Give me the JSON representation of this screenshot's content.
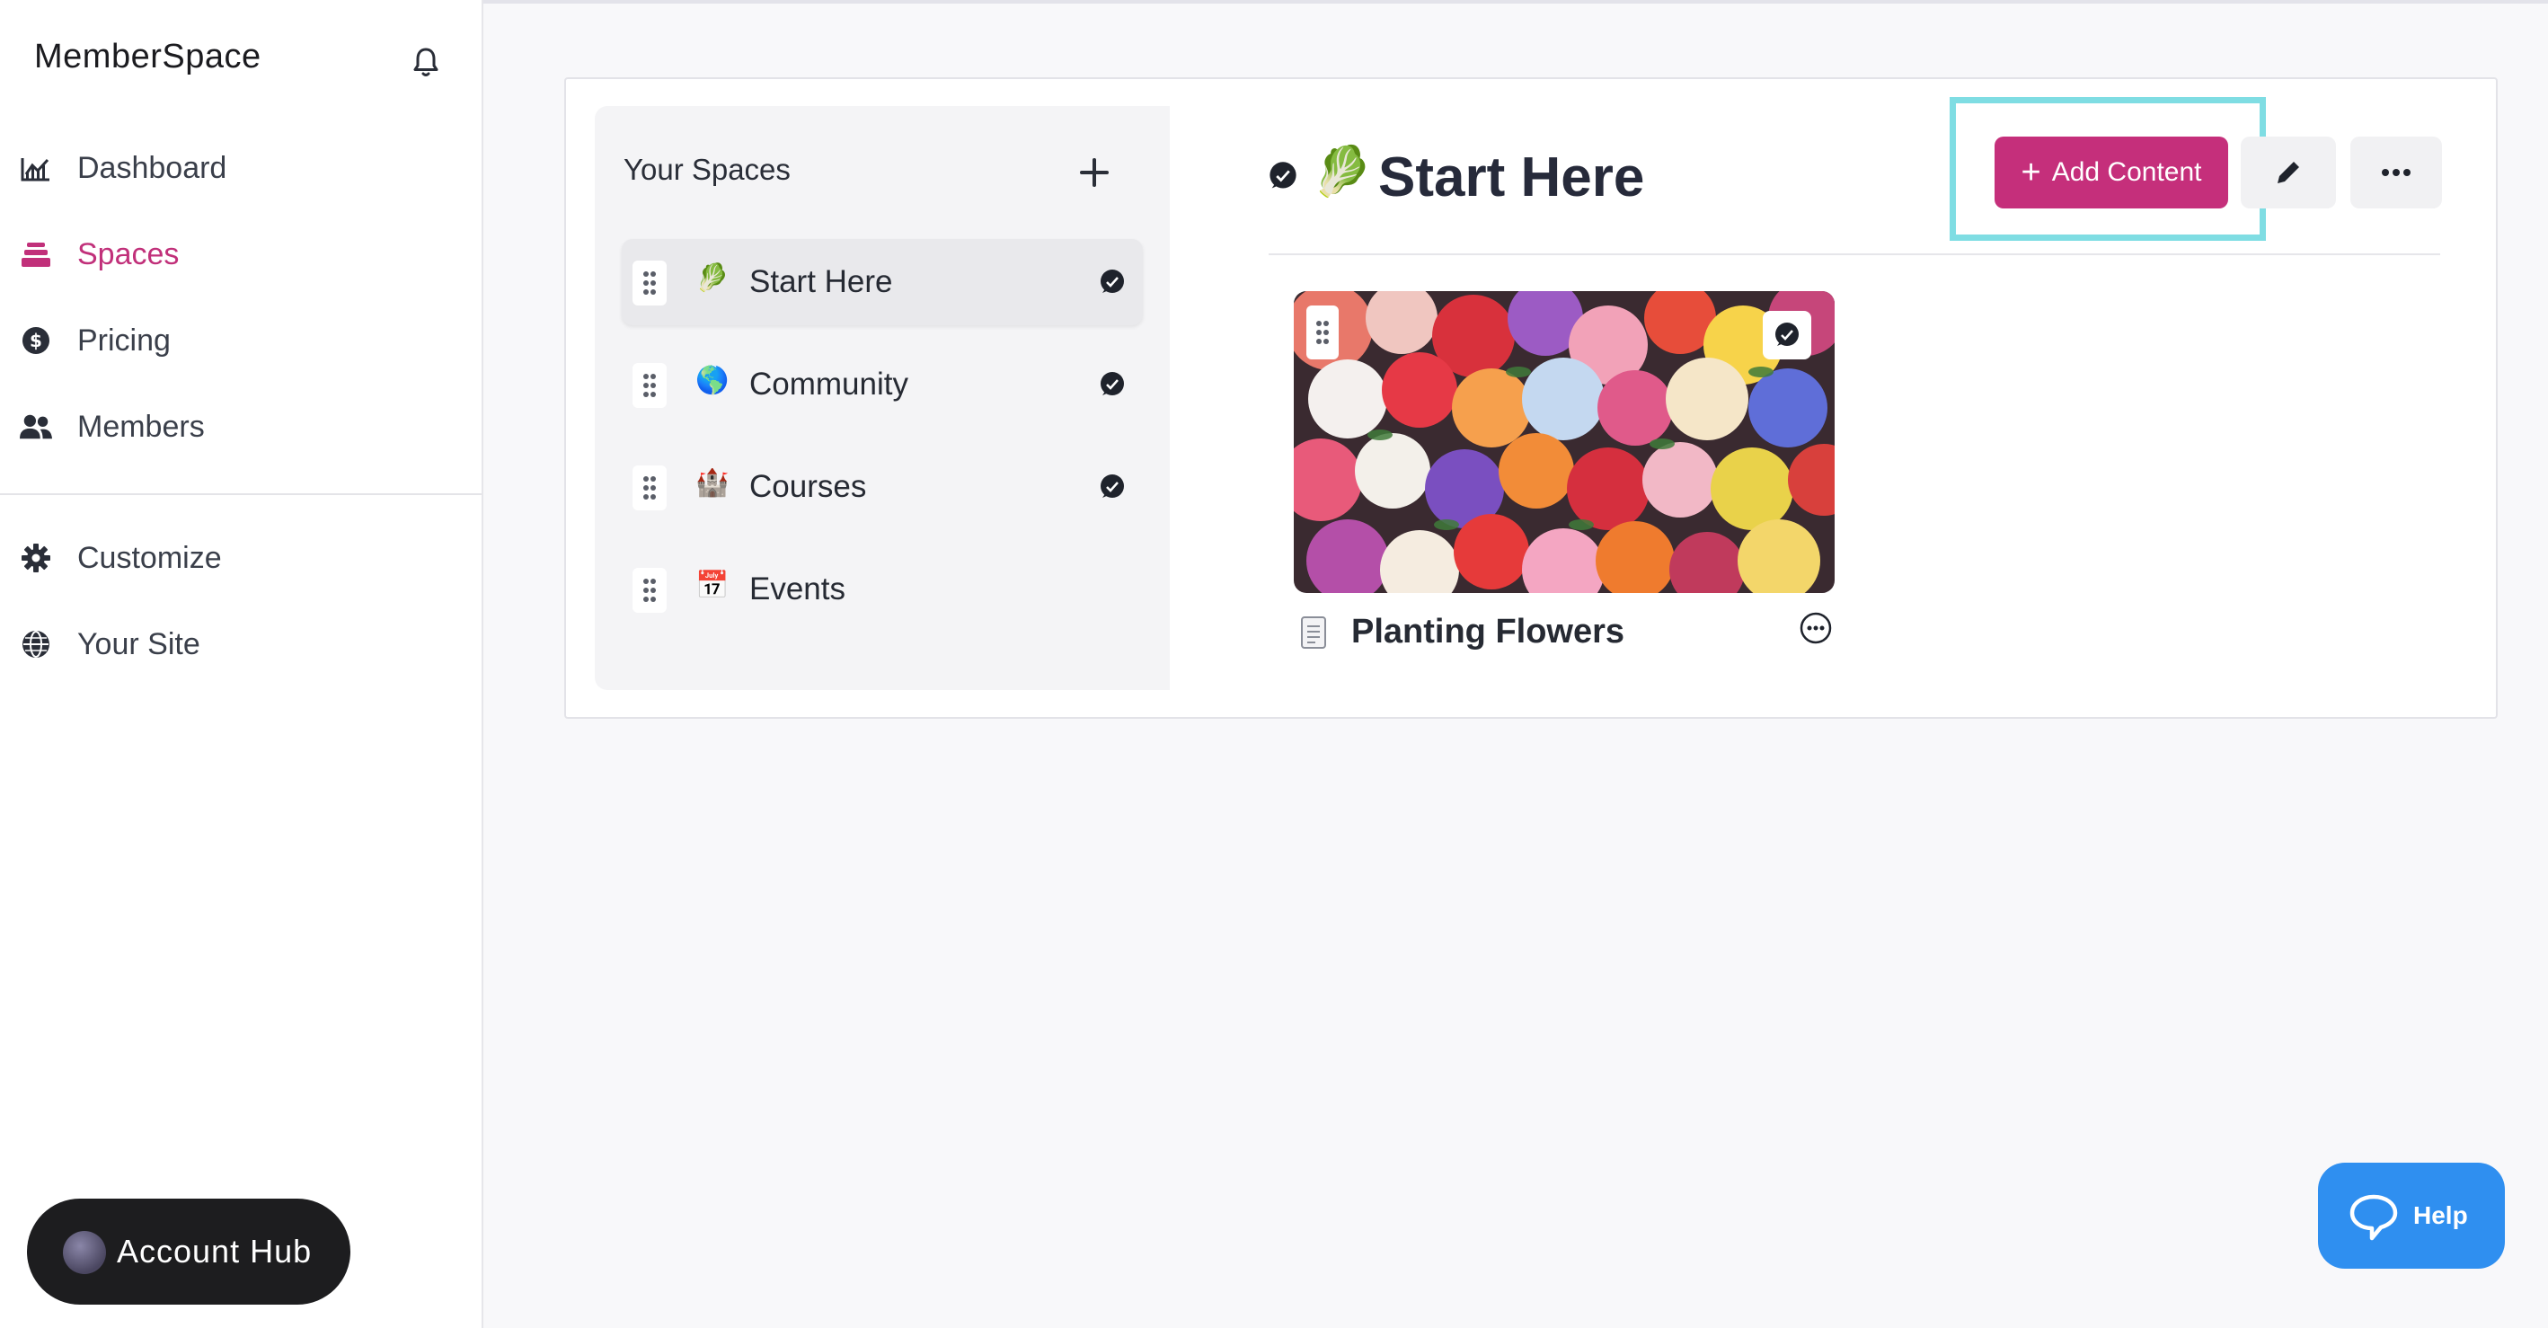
{
  "app": {
    "logo_text": "MemberSpace"
  },
  "sidebar": {
    "items": [
      {
        "label": "Dashboard",
        "icon": "chart-icon"
      },
      {
        "label": "Spaces",
        "icon": "layers-icon",
        "active": true
      },
      {
        "label": "Pricing",
        "icon": "dollar-icon"
      },
      {
        "label": "Members",
        "icon": "users-icon"
      },
      {
        "label": "Customize",
        "icon": "gear-icon"
      },
      {
        "label": "Your Site",
        "icon": "globe-icon"
      }
    ],
    "account_hub": "Account Hub"
  },
  "spaces_panel": {
    "title": "Your Spaces",
    "items": [
      {
        "name": "Start Here",
        "emoji": "🥬",
        "has_chat": true,
        "selected": true
      },
      {
        "name": "Community",
        "emoji": "🌎",
        "has_chat": true
      },
      {
        "name": "Courses",
        "emoji": "🏰",
        "has_chat": true
      },
      {
        "name": "Events",
        "emoji": "📅",
        "has_chat": false
      }
    ]
  },
  "space_header": {
    "emoji": "🥬",
    "title": "Start Here",
    "add_content_label": "Add Content"
  },
  "content": [
    {
      "title": "Planting Flowers",
      "thumbnail": "flower-arrangement-image"
    }
  ],
  "help": {
    "label": "Help"
  },
  "colors": {
    "accent": "#c52f7b",
    "active_nav": "#c1307a",
    "highlight": "#7fdde3",
    "help_button": "#2f8ff0"
  }
}
